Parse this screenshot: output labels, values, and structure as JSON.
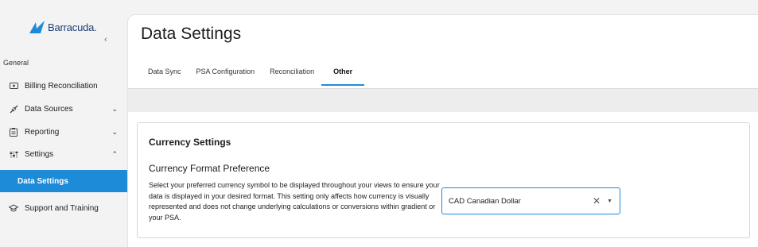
{
  "brand": {
    "name": "Barracuda.",
    "accent": "#1d8bd8"
  },
  "sidebar": {
    "collapse_icon": "chevron-left-icon",
    "section_label": "General",
    "items": [
      {
        "label": "Billing Reconciliation",
        "icon": "billing-icon",
        "has_chevron": false
      },
      {
        "label": "Data Sources",
        "icon": "data-sources-icon",
        "chevron": "⌄"
      },
      {
        "label": "Reporting",
        "icon": "reporting-icon",
        "chevron": "⌄"
      },
      {
        "label": "Settings",
        "icon": "settings-icon",
        "chevron": "⌃"
      },
      {
        "label": "Data Settings",
        "active": true
      },
      {
        "label": "Support and Training",
        "icon": "support-icon"
      }
    ]
  },
  "main": {
    "title": "Data Settings",
    "tabs": [
      {
        "label": "Data Sync"
      },
      {
        "label": "PSA Configuration"
      },
      {
        "label": "Reconciliation"
      },
      {
        "label": "Other",
        "active": true
      }
    ],
    "card": {
      "title": "Currency Settings",
      "subtitle": "Currency Format Preference",
      "description": "Select your preferred currency symbol to be displayed throughout your views to ensure your data is displayed in your desired format. This setting only affects how currency is visually represented and does not change underlying calculations or conversions within gradient or your PSA.",
      "select": {
        "value": "CAD Canadian Dollar",
        "clear": "✕",
        "caret": "▼"
      }
    }
  }
}
